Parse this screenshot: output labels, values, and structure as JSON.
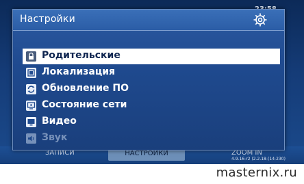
{
  "background": {
    "top_right_text": "23:58",
    "bottom_items": [
      "ЗАПИСИ",
      "ZOOM IN"
    ],
    "active_tab": "НАСТРОЙКИ",
    "version": "4.9.16-r2 (2.2.18-(14-230)"
  },
  "dialog": {
    "title": "Настройки",
    "header_icon": "gear-icon",
    "selected_index": 0,
    "items": [
      {
        "label": "Родительские",
        "icon": "lock-icon"
      },
      {
        "label": "Локализация",
        "icon": "locale-icon"
      },
      {
        "label": "Обновление ПО",
        "icon": "refresh-icon"
      },
      {
        "label": "Состояние сети",
        "icon": "network-icon"
      },
      {
        "label": "Видео",
        "icon": "monitor-icon"
      },
      {
        "label": "Звук",
        "icon": "speaker-icon"
      }
    ]
  },
  "watermark": "masternix.ru",
  "colors": {
    "screen_bg": "#153c78",
    "dialog_bg": "#1f4a8f",
    "selection_bg": "#ffffff",
    "selection_text": "#0f2550"
  }
}
